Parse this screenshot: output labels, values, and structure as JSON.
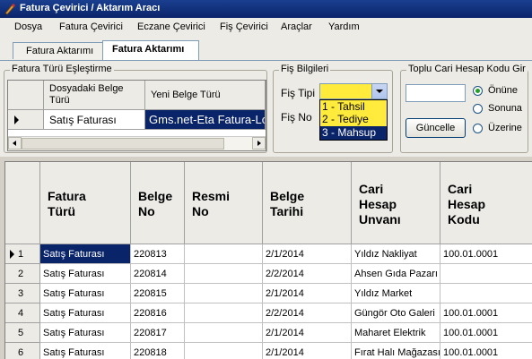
{
  "window": {
    "title": "Fatura Çevirici / Aktarım Aracı"
  },
  "menu": [
    "Dosya",
    "Fatura Çevirici",
    "Eczane Çevirici",
    "Fiş Çevirici",
    "Araçlar",
    "Yardım"
  ],
  "tabs": [
    "Fatura Aktarımı",
    "Fatura Aktarımı"
  ],
  "mapping": {
    "legend": "Fatura Türü Eşleştirme",
    "col1": "Dosyadaki Belge Türü",
    "col2": "Yeni Belge Türü",
    "row_source": "Satış Faturası",
    "row_target": "Gms.net-Eta Fatura-Log"
  },
  "fis": {
    "legend": "Fiş Bilgileri",
    "tipi_label": "Fiş Tipi",
    "no_label": "Fiş No",
    "options": [
      "1 - Tahsil",
      "2 - Tediye",
      "3 - Mahsup"
    ],
    "highlighted_option": "3 - Mahsup"
  },
  "toplu": {
    "legend": "Toplu Cari Hesap Kodu Gir",
    "input_value": "",
    "button": "Güncelle",
    "radios": [
      "Önüne",
      "Sonuna",
      "Üzerine"
    ],
    "selected_radio": "Önüne"
  },
  "grid": {
    "columns": [
      "Fatura Türü",
      "Belge No",
      "Resmi No",
      "Belge Tarihi",
      "Cari Hesap Unvanı",
      "Cari Hesap Kodu"
    ],
    "rows": [
      {
        "n": "1",
        "tur": "Satış Faturası",
        "belge": "220813",
        "resmi": "",
        "tarih": "2/1/2014",
        "unvan": "Yıldız Nakliyat",
        "kod": "100.01.0001"
      },
      {
        "n": "2",
        "tur": "Satış Faturası",
        "belge": "220814",
        "resmi": "",
        "tarih": "2/2/2014",
        "unvan": "Ahsen Gıda Pazarı",
        "kod": ""
      },
      {
        "n": "3",
        "tur": "Satış Faturası",
        "belge": "220815",
        "resmi": "",
        "tarih": "2/1/2014",
        "unvan": "Yıldız Market",
        "kod": ""
      },
      {
        "n": "4",
        "tur": "Satış Faturası",
        "belge": "220816",
        "resmi": "",
        "tarih": "2/2/2014",
        "unvan": "Güngör Oto Galeri",
        "kod": "100.01.0001"
      },
      {
        "n": "5",
        "tur": "Satış Faturası",
        "belge": "220817",
        "resmi": "",
        "tarih": "2/1/2014",
        "unvan": "Maharet Elektrik",
        "kod": "100.01.0001"
      },
      {
        "n": "6",
        "tur": "Satış Faturası",
        "belge": "220818",
        "resmi": "",
        "tarih": "2/1/2014",
        "unvan": "Fırat Halı Mağazası",
        "kod": "100.01.0001"
      }
    ]
  }
}
